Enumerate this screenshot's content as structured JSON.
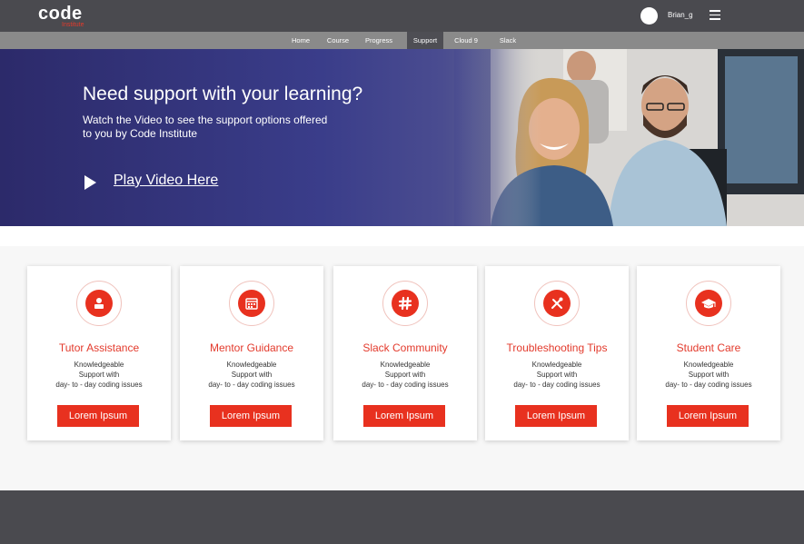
{
  "header": {
    "logo_text": "code",
    "logo_sub": "Institute",
    "username": "Brian_g"
  },
  "nav": {
    "items": [
      {
        "label": "Home"
      },
      {
        "label": "Course"
      },
      {
        "label": "Progress"
      },
      {
        "label": "Support",
        "active": true
      },
      {
        "label": "Cloud 9"
      },
      {
        "label": "Slack"
      }
    ]
  },
  "hero": {
    "title": "Need support with your learning?",
    "subtitle_line1": "Watch the Video to see the support options offered",
    "subtitle_line2": "to you by Code Institute",
    "play_label": "Play Video Here"
  },
  "cards": [
    {
      "title": "Tutor Assistance",
      "line1": "Knowledgeable",
      "line2": "Support with",
      "line3": "day- to - day coding issues",
      "button": "Lorem Ipsum",
      "icon": "tutor-stamp-icon"
    },
    {
      "title": "Mentor Guidance",
      "line1": "Knowledgeable",
      "line2": "Support with",
      "line3": "day- to - day coding issues",
      "button": "Lorem Ipsum",
      "icon": "calendar-icon"
    },
    {
      "title": "Slack Community",
      "line1": "Knowledgeable",
      "line2": "Support with",
      "line3": "day- to - day coding issues",
      "button": "Lorem Ipsum",
      "icon": "slack-hash-icon"
    },
    {
      "title": "Troubleshooting Tips",
      "line1": "Knowledgeable",
      "line2": "Support with",
      "line3": "day- to - day coding issues",
      "button": "Lorem Ipsum",
      "icon": "tools-icon"
    },
    {
      "title": "Student Care",
      "line1": "Knowledgeable",
      "line2": "Support with",
      "line3": "day- to - day coding issues",
      "button": "Lorem Ipsum",
      "icon": "graduation-cap-icon"
    }
  ],
  "colors": {
    "accent": "#e8311f",
    "header_bg": "#4a4a4f",
    "nav_bg": "#8a8a8a",
    "hero_bg": "#2c2a6a"
  }
}
